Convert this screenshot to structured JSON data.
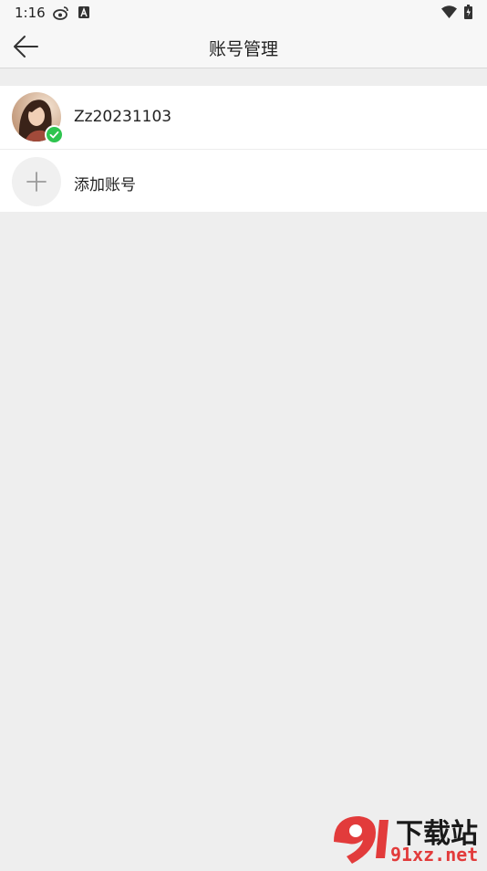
{
  "status_bar": {
    "time": "1:16",
    "icons": [
      "weibo-icon",
      "app-a-icon",
      "wifi-icon",
      "battery-icon"
    ]
  },
  "header": {
    "title": "账号管理",
    "back_icon": "arrow-left-icon"
  },
  "accounts": [
    {
      "username": "Zz20231103",
      "active": true,
      "badge_color": "#2ec44f"
    }
  ],
  "add_account": {
    "label": "添加账号",
    "icon": "plus-icon"
  },
  "watermark": {
    "brand": "下载站",
    "domain": "91xz.net"
  },
  "colors": {
    "background": "#eeeeee",
    "header_bg": "#f7f7f7",
    "check_green": "#2ec44f",
    "watermark_red": "#e23b3b"
  }
}
